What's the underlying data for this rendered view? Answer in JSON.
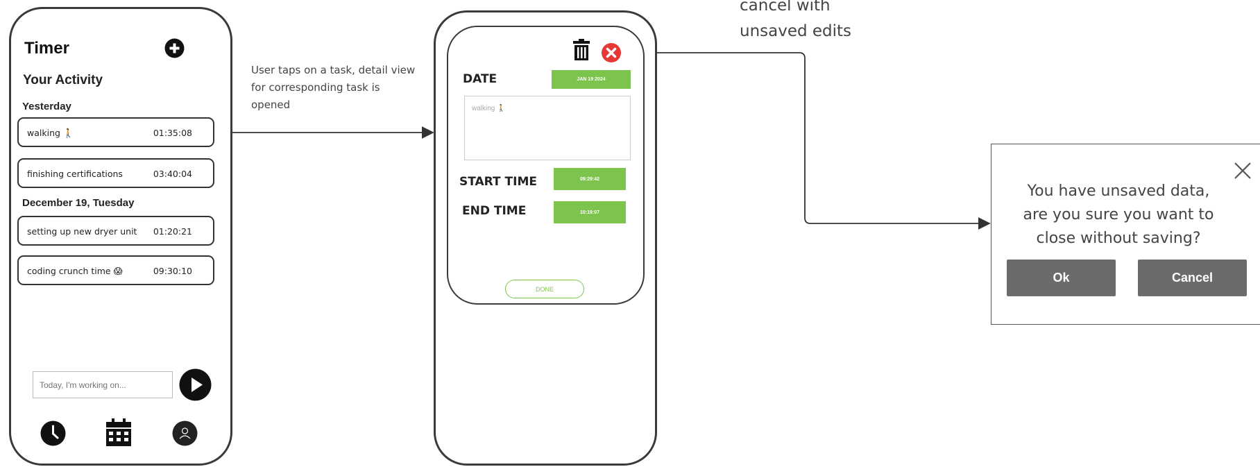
{
  "timer_screen": {
    "title": "Timer",
    "subtitle": "Your Activity",
    "sections": [
      {
        "heading": "Yesterday",
        "tasks": [
          {
            "name": "walking 🚶",
            "time": "01:35:08"
          },
          {
            "name": "finishing certifications",
            "time": "03:40:04"
          }
        ]
      },
      {
        "heading": "December 19, Tuesday",
        "tasks": [
          {
            "name": "setting up new dryer unit",
            "time": "01:20:21"
          },
          {
            "name": "coding crunch time 😱",
            "time": "09:30:10"
          }
        ]
      }
    ],
    "input_placeholder": "Today, I'm working on...",
    "icons": {
      "add": "plus-circle-icon",
      "play": "play-icon",
      "clock": "clock-icon",
      "calendar": "calendar-icon",
      "profile": "user-icon"
    }
  },
  "annotation_tap": "User taps on a task, detail view for corresponding task is opened",
  "detail_view": {
    "date_label": "DATE",
    "date_value": "JAN 19 2024",
    "description": "walking 🚶",
    "start_label": "START TIME",
    "start_value": "09:29:42",
    "end_label": "END TIME",
    "end_value": "10:19:07",
    "done_label": "DONE",
    "icons": {
      "delete": "trash-icon",
      "close": "close-circle-icon"
    },
    "colors": {
      "accent": "#7dc44e",
      "close": "#e53935"
    }
  },
  "annotation_cancel": "cancel with unsaved edits",
  "dialog": {
    "message": "You have unsaved data, are you sure you want to close without saving?",
    "ok_label": "Ok",
    "cancel_label": "Cancel"
  }
}
